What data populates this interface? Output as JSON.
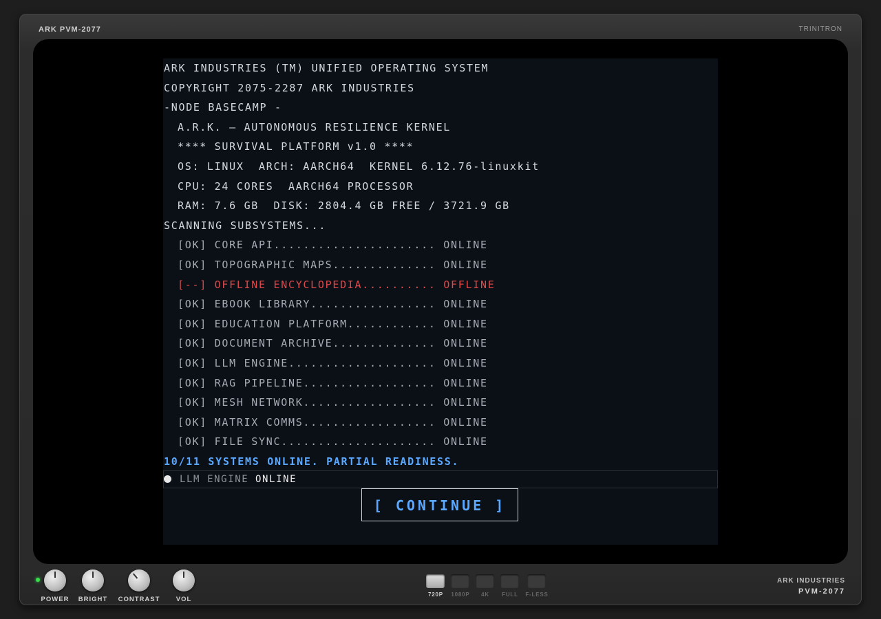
{
  "monitor": {
    "brand_top_left": "ARK PVM-2077",
    "brand_top_right": "TRINITRON",
    "brand_bottom_1": "ARK INDUSTRIES",
    "brand_bottom_2": "PVM-2077"
  },
  "terminal": {
    "header": [
      "ARK INDUSTRIES (TM) UNIFIED OPERATING SYSTEM",
      "COPYRIGHT 2075-2287 ARK INDUSTRIES",
      "-NODE BASECAMP -"
    ],
    "info": [
      "A.R.K. — AUTONOMOUS RESILIENCE KERNEL",
      "**** SURVIVAL PLATFORM v1.0 ****",
      "OS: LINUX  ARCH: AARCH64  KERNEL 6.12.76-linuxkit",
      "CPU: 24 CORES  AARCH64 PROCESSOR",
      "RAM: 7.6 GB  DISK: 2804.4 GB FREE / 3721.9 GB"
    ],
    "scanning": "SCANNING SUBSYSTEMS...",
    "subsystems": [
      "[OK] CORE API...................... ONLINE",
      "[OK] TOPOGRAPHIC MAPS.............. ONLINE",
      "[--] OFFLINE ENCYCLOPEDIA.......... OFFLINE",
      "[OK] EBOOK LIBRARY................. ONLINE",
      "[OK] EDUCATION PLATFORM............ ONLINE",
      "[OK] DOCUMENT ARCHIVE.............. ONLINE",
      "[OK] LLM ENGINE.................... ONLINE",
      "[OK] RAG PIPELINE.................. ONLINE",
      "[OK] MESH NETWORK.................. ONLINE",
      "[OK] MATRIX COMMS.................. ONLINE",
      "[OK] FILE SYNC..................... ONLINE"
    ],
    "summary": "10/11 SYSTEMS ONLINE. PARTIAL READINESS.",
    "status_label": "LLM ENGINE",
    "status_value": "ONLINE",
    "continue_label": "[ CONTINUE ]"
  },
  "controls": {
    "knobs": [
      "POWER",
      "BRIGHT",
      "CONTRAST",
      "VOL"
    ],
    "resolutions": [
      "720P",
      "1080P",
      "4K",
      "FULL",
      "F-LESS"
    ],
    "active_resolution": "720P"
  },
  "colors": {
    "ok_text": "#a7acb4",
    "offline_text": "#e2484a",
    "accent_blue": "#5aa8ff",
    "power_led": "#35e04a"
  }
}
